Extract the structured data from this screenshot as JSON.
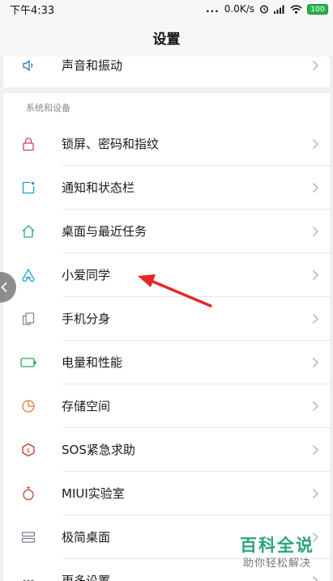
{
  "status_bar": {
    "time": "下午4:33",
    "dots": "...",
    "network_speed": "0.0K/s",
    "battery": "100",
    "icons": [
      "alarm-icon",
      "signal-icon",
      "wifi-icon",
      "battery-icon"
    ]
  },
  "header": {
    "title": "设置"
  },
  "top_card": {
    "items": [
      {
        "label": "声音和振动",
        "icon": "speaker-icon"
      }
    ]
  },
  "section": {
    "header": "系统和设备",
    "items": [
      {
        "label": "锁屏、密码和指纹",
        "icon": "lock-icon",
        "color": "#c8455b"
      },
      {
        "label": "通知和状态栏",
        "icon": "notification-icon",
        "color": "#17a5c2"
      },
      {
        "label": "桌面与最近任务",
        "icon": "home-icon",
        "color": "#29a87a"
      },
      {
        "label": "小爱同学",
        "icon": "xiaoai-icon",
        "color": "#21a3d6"
      },
      {
        "label": "手机分身",
        "icon": "dual-phone-icon",
        "color": "#888888"
      },
      {
        "label": "电量和性能",
        "icon": "battery-icon",
        "color": "#2aa65b"
      },
      {
        "label": "存储空间",
        "icon": "storage-pie-icon",
        "color": "#e07b3a"
      },
      {
        "label": "SOS紧急求助",
        "icon": "sos-icon",
        "color": "#c0392b"
      },
      {
        "label": "MIUI实验室",
        "icon": "flask-icon",
        "color": "#c04a3a"
      },
      {
        "label": "极简桌面",
        "icon": "minimal-desktop-icon",
        "color": "#7d7d8f"
      },
      {
        "label": "更多设置",
        "icon": "more-icon",
        "color": "#666666"
      }
    ]
  },
  "watermark": {
    "title": "百科全说",
    "subtitle": "助你轻松解决"
  },
  "colors": {
    "accent_arrow": "#e82525",
    "watermark": "#2aa57a"
  }
}
